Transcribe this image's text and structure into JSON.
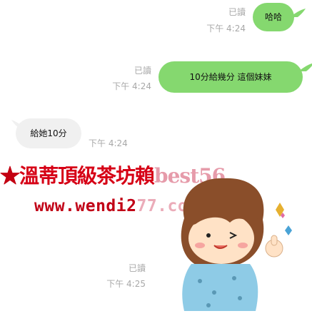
{
  "messages": [
    {
      "id": "m1",
      "side": "right",
      "read": "已讀",
      "time": "下午 4:24",
      "text": "哈哈"
    },
    {
      "id": "m2",
      "side": "right",
      "read": "已讀",
      "time": "下午 4:24",
      "text": "10分給幾分 這個妹妹"
    },
    {
      "id": "m3",
      "side": "left",
      "time": "下午 4:24",
      "text": "給她10分"
    },
    {
      "id": "m4",
      "side": "right",
      "read": "已讀",
      "time": "下午 4:25"
    }
  ],
  "promo": {
    "star": "★",
    "line1_main": "溫蒂頂級茶坊賴",
    "line1_tail": "best56",
    "line2_main": "www.wendi2",
    "line2_tail": "77.com"
  },
  "colors": {
    "bubble_sent": "#85d86f",
    "bubble_received": "#f0f0f0",
    "meta_text": "#a8a8a8",
    "promo_red": "#d60016"
  }
}
